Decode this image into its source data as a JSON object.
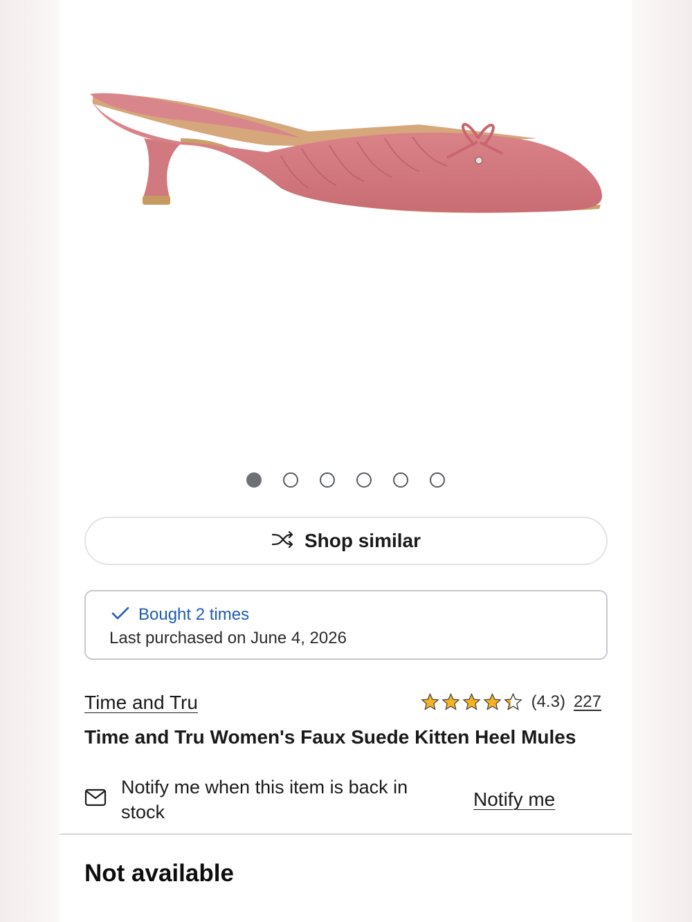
{
  "product_image": {
    "icon": "pink-kitten-heel-mule-image",
    "color": "#d4787e"
  },
  "carousel": {
    "total_images": 6,
    "active_index": 0
  },
  "shop_similar": {
    "label": "Shop similar",
    "icon": "shuffle-icon"
  },
  "purchase_history": {
    "bought_label": "Bought 2 times",
    "last_purchased": "Last purchased on June 4, 2026",
    "check_color": "#1e5cae"
  },
  "product": {
    "brand": "Time and Tru",
    "title": "Time and Tru Women's Faux Suede Kitten Heel Mules",
    "rating_value": "(4.3)",
    "rating": 4.3,
    "review_count": "227",
    "star_color": "#f5b324"
  },
  "notify": {
    "text": "Notify me when this item is back in stock",
    "link_label": "Notify me",
    "icon": "mail-icon"
  },
  "availability": {
    "status": "Not available"
  }
}
